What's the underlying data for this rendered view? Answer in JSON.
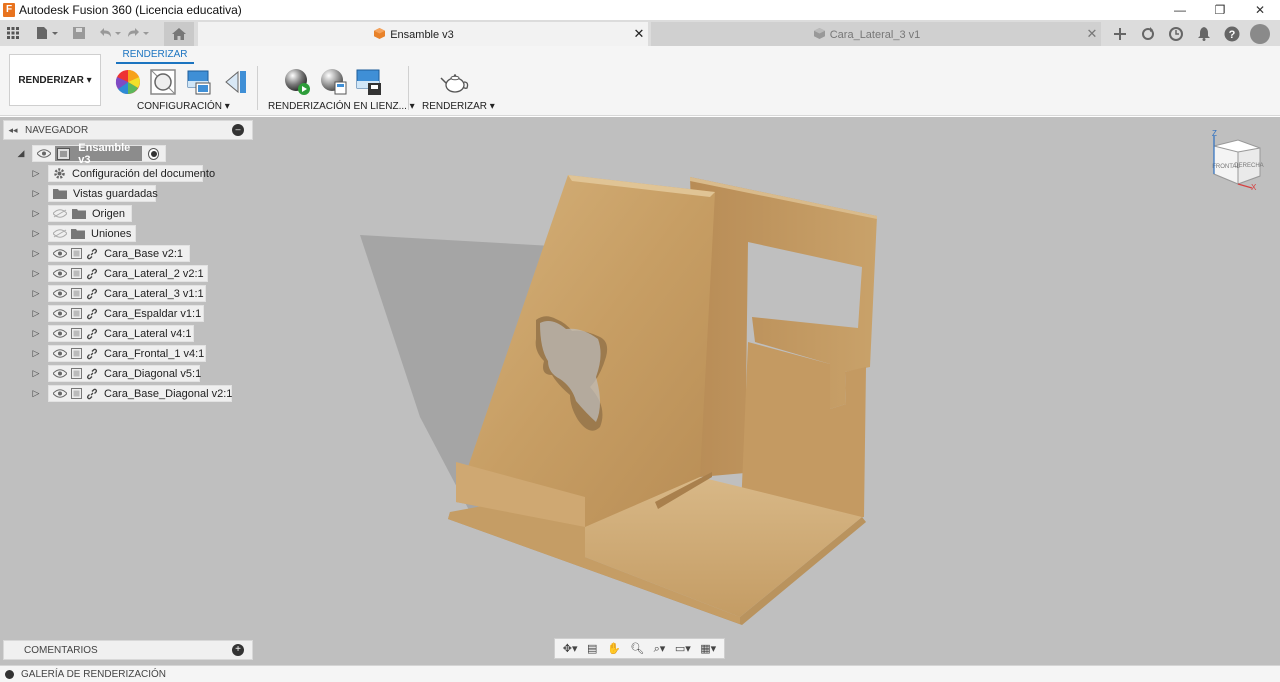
{
  "window": {
    "app_icon": "F",
    "title": "Autodesk Fusion 360 (Licencia educativa)",
    "controls": [
      "—",
      "❐",
      "✕"
    ]
  },
  "tabbar": {
    "tabs": [
      {
        "label": "Ensamble v3",
        "active": true,
        "close": "✕"
      },
      {
        "label": "Cara_Lateral_3 v1",
        "active": false,
        "close": "✕"
      }
    ],
    "right_icons": [
      "plus-icon",
      "sync-icon",
      "clock-icon",
      "bell-icon",
      "help-icon",
      "user-avatar"
    ]
  },
  "ribbon": {
    "workspace_label": "RENDERIZAR ▾",
    "active_tab": "RENDERIZAR",
    "groups": [
      {
        "label": "CONFIGURACIÓN ▾"
      },
      {
        "label": "RENDERIZACIÓN EN LIENZ... ▾"
      },
      {
        "label": "RENDERIZAR ▾"
      }
    ]
  },
  "navigator": {
    "title": "NAVEGADOR",
    "root": "Ensamble v3",
    "items": [
      {
        "label": "Configuración del documento",
        "icon": "gear-icon",
        "eye": false,
        "link": false
      },
      {
        "label": "Vistas guardadas",
        "icon": "folder-icon",
        "eye": false,
        "link": false
      },
      {
        "label": "Origen",
        "icon": "folder-icon",
        "eye": "hidden",
        "link": false
      },
      {
        "label": "Uniones",
        "icon": "folder-icon",
        "eye": "hidden",
        "link": false
      },
      {
        "label": "Cara_Base v2:1",
        "icon": "component-icon",
        "eye": true,
        "link": true
      },
      {
        "label": "Cara_Lateral_2 v2:1",
        "icon": "component-icon",
        "eye": true,
        "link": true
      },
      {
        "label": "Cara_Lateral_3 v1:1",
        "icon": "component-icon",
        "eye": true,
        "link": true
      },
      {
        "label": "Cara_Espaldar v1:1",
        "icon": "component-icon",
        "eye": true,
        "link": true
      },
      {
        "label": "Cara_Lateral v4:1",
        "icon": "component-icon",
        "eye": true,
        "link": true
      },
      {
        "label": "Cara_Frontal_1 v4:1",
        "icon": "component-icon",
        "eye": true,
        "link": true
      },
      {
        "label": "Cara_Diagonal v5:1",
        "icon": "component-icon",
        "eye": true,
        "link": true
      },
      {
        "label": "Cara_Base_Diagonal v2:1",
        "icon": "component-icon",
        "eye": true,
        "link": true
      }
    ]
  },
  "comments": {
    "title": "COMENTARIOS"
  },
  "gallery": {
    "title": "GALERÍA DE RENDERIZACIÓN"
  },
  "viewcube": {
    "front_label": "FRONTAL",
    "right_label": "DERECHA",
    "axis_z": "Z",
    "axis_x": "X"
  },
  "colors": {
    "wood": "#c9a26a",
    "viewport_bg": "#bfbfbf",
    "accent": "#1b74c0"
  }
}
